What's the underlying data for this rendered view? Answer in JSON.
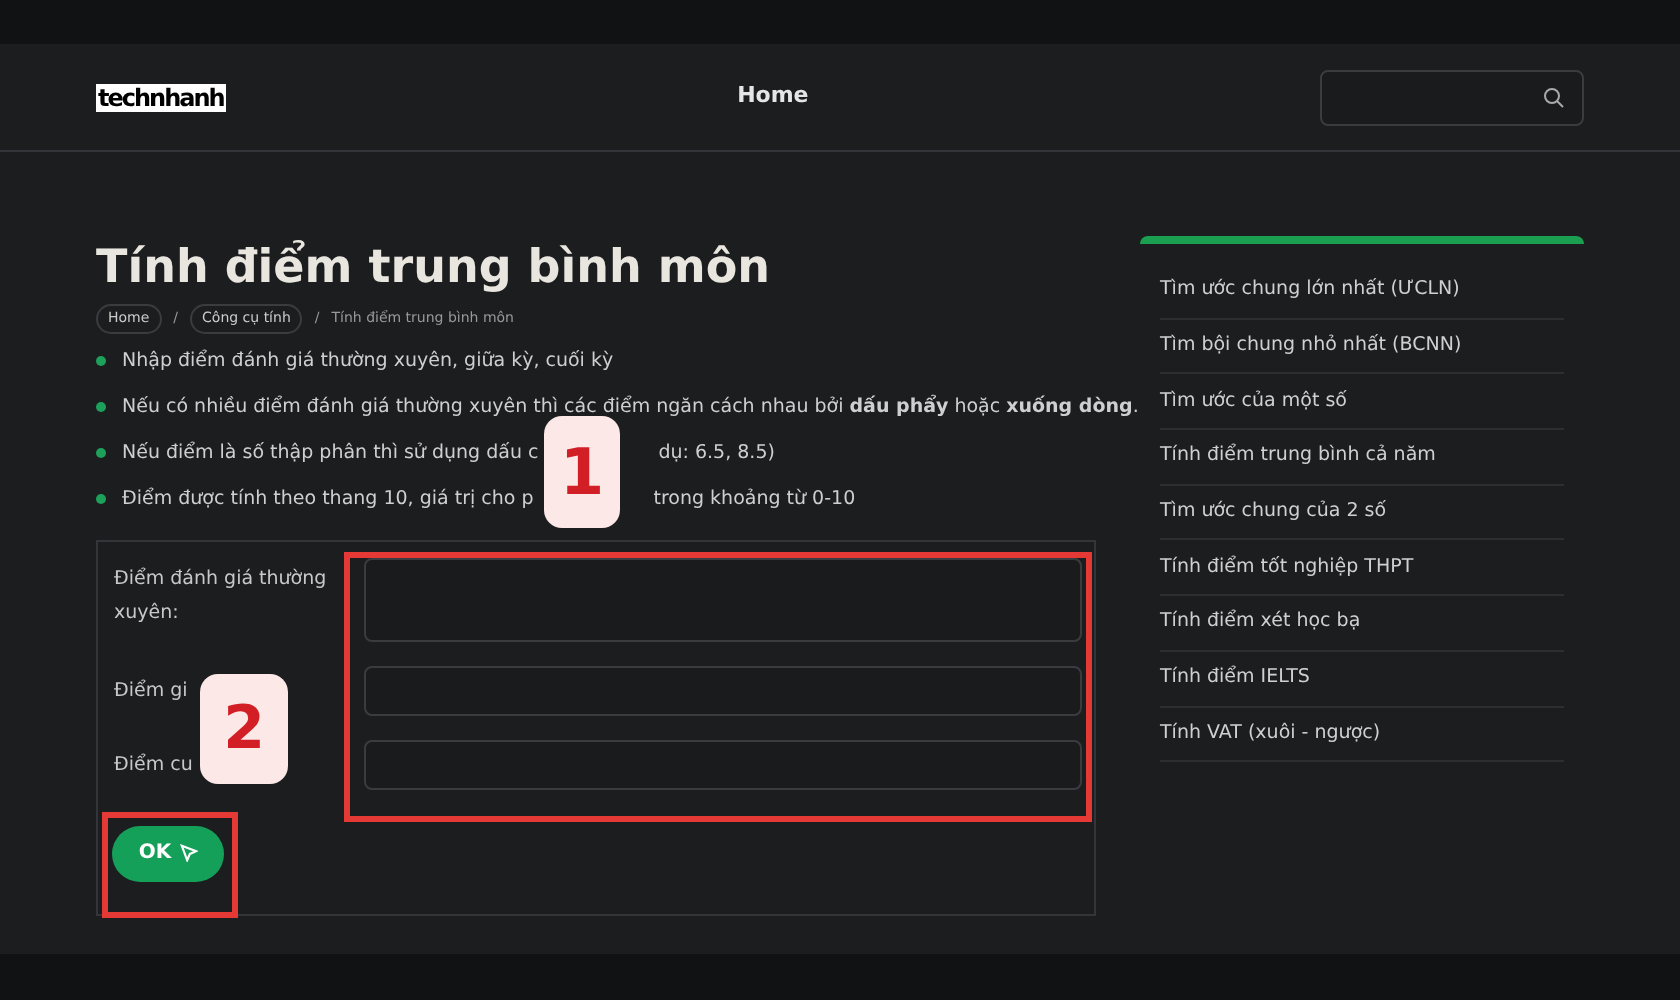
{
  "header": {
    "logo": "technhanh",
    "nav": [
      "Home"
    ]
  },
  "title": "Tính điểm trung bình môn",
  "breadcrumbs": [
    {
      "label": "Home",
      "kind": "link"
    },
    {
      "label": "/",
      "kind": "separator"
    },
    {
      "label": "Công cụ tính",
      "kind": "link"
    },
    {
      "label": "/",
      "kind": "separator"
    },
    {
      "label": "Tính điểm trung bình môn",
      "kind": "current"
    }
  ],
  "bullets": [
    {
      "text": "Nhập điểm đánh giá thường xuyên, giữa kỳ, cuối kỳ"
    },
    {
      "text": "Nếu có nhiều điểm đánh giá thường xuyên thì các điểm ngăn cách nhau bởi **dấu phẩy** hoặc **xuống dòng**."
    },
    {
      "text": "Nếu điểm là số thập phân thì sử dụng dấu c",
      "continued": "dụ: 6.5, 8.5)"
    },
    {
      "text": "Điểm được tính theo thang 10, giá trị cho p",
      "continued": "trong khoảng từ 0-10"
    }
  ],
  "form": {
    "fields": [
      {
        "label": "Điểm đánh giá thường xuyên:",
        "kind": "textarea"
      },
      {
        "label": "Điểm gi",
        "kind": "input"
      },
      {
        "label": "Điểm cu",
        "kind": "input"
      }
    ],
    "button": "OK"
  },
  "sidebar": {
    "items": [
      "Tìm ước chung lớn nhất (ƯCLN)",
      "Tìm bội chung nhỏ nhất (BCNN)",
      "Tìm ước của một số",
      "Tính điểm trung bình cả năm",
      "Tìm ước chung của 2 số",
      "Tính điểm tốt nghiệp THPT",
      "Tính điểm xét học bạ",
      "Tính điểm IELTS",
      "Tính VAT (xuôi - ngược)"
    ]
  },
  "annotations": [
    "1",
    "2"
  ]
}
